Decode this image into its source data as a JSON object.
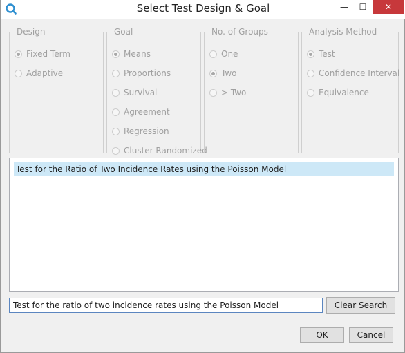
{
  "window": {
    "title": "Select Test Design & Goal",
    "minimize_glyph": "—",
    "maximize_glyph": "☐",
    "close_glyph": "✕"
  },
  "groups": {
    "design": {
      "legend": "Design",
      "options": [
        "Fixed Term",
        "Adaptive"
      ],
      "selected": "Fixed Term"
    },
    "goal": {
      "legend": "Goal",
      "options": [
        "Means",
        "Proportions",
        "Survival",
        "Agreement",
        "Regression",
        "Cluster Randomized"
      ],
      "selected": "Means"
    },
    "groups": {
      "legend": "No. of Groups",
      "options": [
        "One",
        "Two",
        "> Two"
      ],
      "selected": "Two"
    },
    "method": {
      "legend": "Analysis Method",
      "options": [
        "Test",
        "Confidence Interval",
        "Equivalence"
      ],
      "selected": "Test"
    }
  },
  "results": {
    "items": [
      "Test for the Ratio of Two Incidence Rates using the Poisson Model"
    ],
    "selected_index": 0
  },
  "search": {
    "value": "Test for the ratio of two incidence rates using the Poisson Model",
    "clear_label": "Clear Search"
  },
  "footer": {
    "ok_label": "OK",
    "cancel_label": "Cancel"
  },
  "colors": {
    "accent": "#2e8fd0",
    "selection": "#cde8f7",
    "close": "#c7383b"
  },
  "icons": {
    "app": "app-logo-icon",
    "radio": "radio-icon"
  }
}
